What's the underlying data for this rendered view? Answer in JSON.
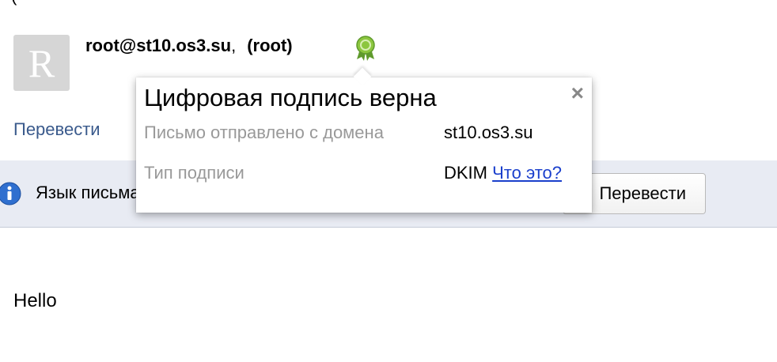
{
  "message": {
    "top_clipped": "(",
    "avatar_letter": "R",
    "sender_email": "root@st10.os3.su",
    "sender_comma": ",",
    "sender_name": "(root)",
    "translate_link": "Перевести",
    "body": "Hello"
  },
  "language_bar": {
    "text": "Язык письма",
    "translate_button": "Перевести"
  },
  "popup": {
    "title": "Цифровая подпись верна",
    "close": "×",
    "rows": [
      {
        "label": "Письмо отправлено с домена",
        "value": "st10.os3.su"
      },
      {
        "label": "Тип подписи",
        "value": "DKIM",
        "link": "Что это?"
      }
    ]
  },
  "colors": {
    "link": "#3a5a8c",
    "popup_link": "#1a3fcc",
    "label_gray": "#999999",
    "bar_bg": "#e8ebf3",
    "badge_green": "#7dbb3a"
  },
  "icons": {
    "badge": "verified-ribbon-icon",
    "info": "info-icon",
    "close": "close-icon"
  }
}
